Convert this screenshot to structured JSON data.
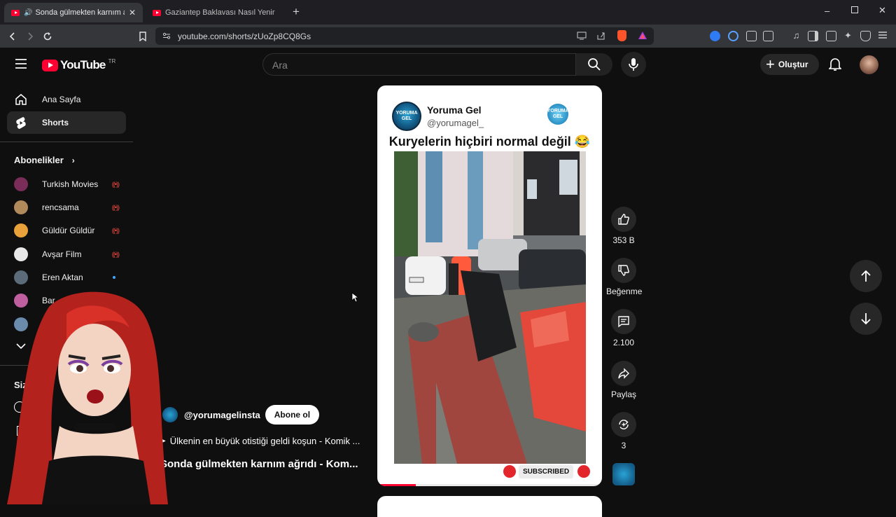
{
  "browser": {
    "tabs": [
      {
        "title": "Sonda gülmekten karnım ağrı",
        "active": true,
        "audio": true
      },
      {
        "title": "Gaziantep Baklavası Nasıl Yenir ? - Ko",
        "active": false
      }
    ],
    "url": "youtube.com/shorts/zUoZp8CQ8Gs"
  },
  "youtube": {
    "logo_text": "YouTube",
    "country": "TR",
    "search_placeholder": "Ara",
    "create_label": "Oluştur",
    "nav": {
      "home": "Ana Sayfa",
      "shorts": "Shorts",
      "subscriptions_header": "Abonelikler",
      "you_header": "Siz"
    },
    "subscriptions": [
      {
        "name": "Turkish Movies",
        "status": "live",
        "color": "#7b2d5a"
      },
      {
        "name": "rencsama",
        "status": "live",
        "color": "#b08a5a"
      },
      {
        "name": "Güldür Güldür",
        "status": "live",
        "color": "#e9a13b"
      },
      {
        "name": "Avşar Film",
        "status": "live",
        "color": "#e8e8e8"
      },
      {
        "name": "Eren Aktan",
        "status": "new",
        "color": "#5b6b7a"
      },
      {
        "name": "Bar",
        "status": "",
        "color": "#c05fa0"
      },
      {
        "name": "",
        "status": "",
        "color": "#6b8bad"
      }
    ]
  },
  "short": {
    "channel_title": "Yoruma Gel",
    "channel_handle": "@yorumagel_",
    "avatar_text": "YORUMA GEL",
    "caption": "Kuryelerin hiçbiri normal değil 😂",
    "subscribed_tag": "SUBSCRIBED",
    "progress": 0.17,
    "actions": {
      "likes": "353 B",
      "dislike": "Beğenme",
      "comments": "2.100",
      "share": "Paylaş",
      "remix": "3"
    },
    "channel": "@yorumagelinsta",
    "subscribe": "Abone ol",
    "related": "Ülkenin en büyük otistiği geldi koşun - Komik ...",
    "title": "Sonda gülmekten karnım ağrıdı - Kom..."
  }
}
